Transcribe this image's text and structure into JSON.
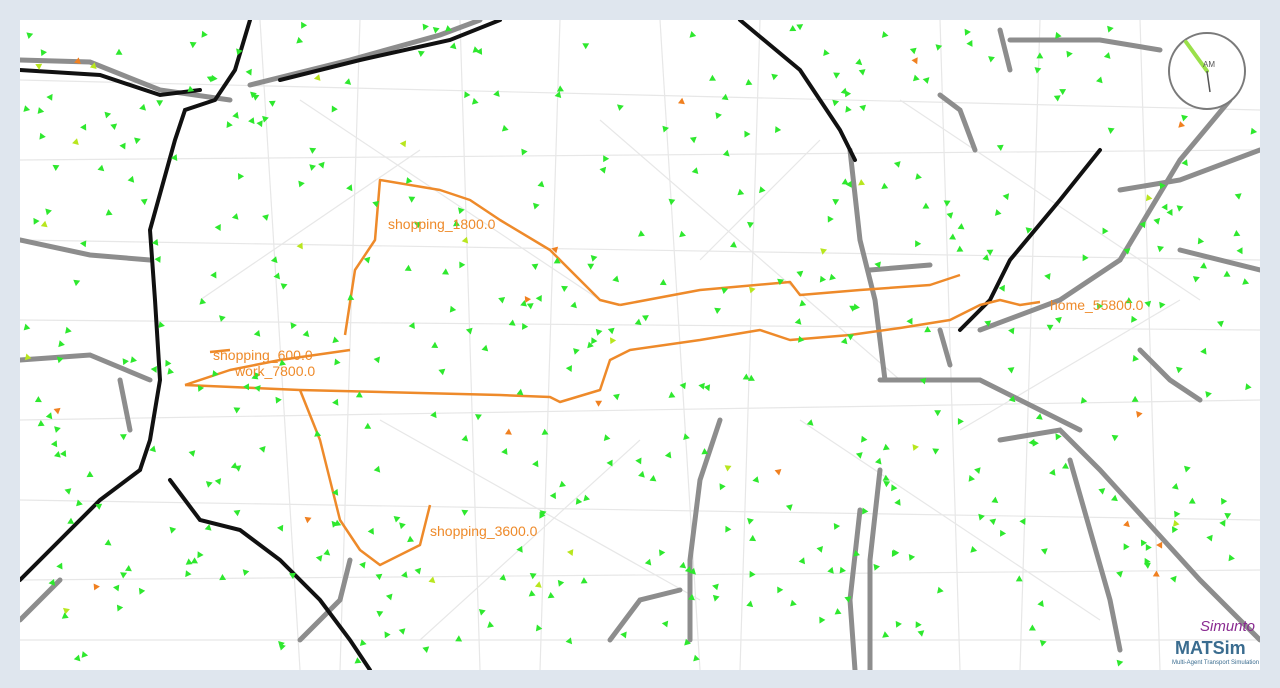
{
  "labels": {
    "shopping_1": "shopping_1800.0",
    "shopping_2": "shopping_3600.0",
    "shopping_3": "shopping_600.0",
    "work": "work_7800.0",
    "home": "home_55800.0",
    "clock_ampm": "AM"
  },
  "logo": {
    "simunto": "Simunto",
    "matsim": "MATSim",
    "subtitle": "Multi-Agent Transport Simulation"
  },
  "colors": {
    "route": "#ee8a2a",
    "agent": "#2ee82e",
    "agent_slow": "#f08020",
    "road_major": "#8d8d8d",
    "rail": "#111111",
    "minor": "#e6e6e6"
  }
}
